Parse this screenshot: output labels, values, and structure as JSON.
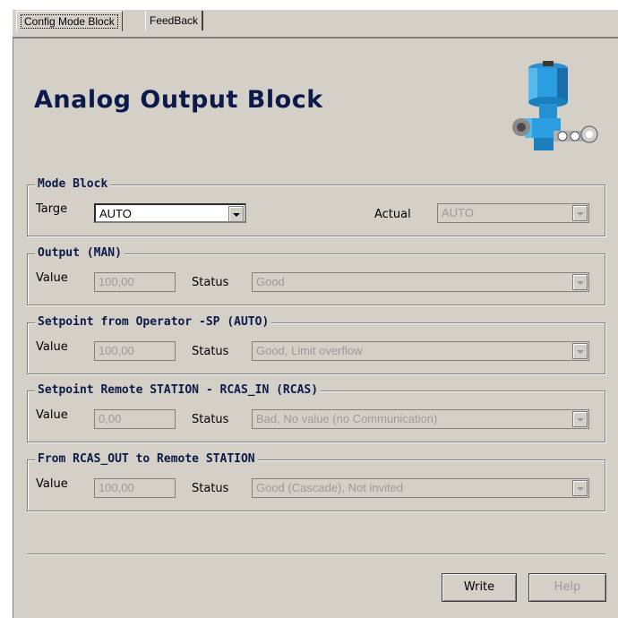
{
  "tabs": [
    {
      "label": "Config Mode Block"
    },
    {
      "label": "FeedBack"
    }
  ],
  "title": "Analog Output Block",
  "mode_block": {
    "legend": "Mode Block",
    "target_label": "Targe",
    "target_value": "AUTO",
    "actual_label": "Actual",
    "actual_value": "AUTO"
  },
  "output_man": {
    "legend": "Output (MAN)",
    "value_label": "Value",
    "value": "100,00",
    "status_label": "Status",
    "status": "Good"
  },
  "setpoint_operator": {
    "legend": "Setpoint from Operator -SP (AUTO)",
    "value_label": "Value",
    "value": "100,00",
    "status_label": "Status",
    "status": "Good, Limit overflow"
  },
  "setpoint_remote": {
    "legend": "Setpoint Remote STATION - RCAS_IN (RCAS)",
    "value_label": "Value",
    "value": "0,00",
    "status_label": "Status",
    "status": "Bad, No value (no Communication)"
  },
  "rcas_out": {
    "legend": "From RCAS_OUT to Remote STATION",
    "value_label": "Value",
    "value": "100,00",
    "status_label": "Status",
    "status": "Good (Cascade), Not invited"
  },
  "buttons": {
    "write": "Write",
    "help": "Help"
  },
  "colors": {
    "panel_bg": "#d4d0c8",
    "title": "#0b1a4a",
    "disabled_text": "#9a9a9a"
  }
}
